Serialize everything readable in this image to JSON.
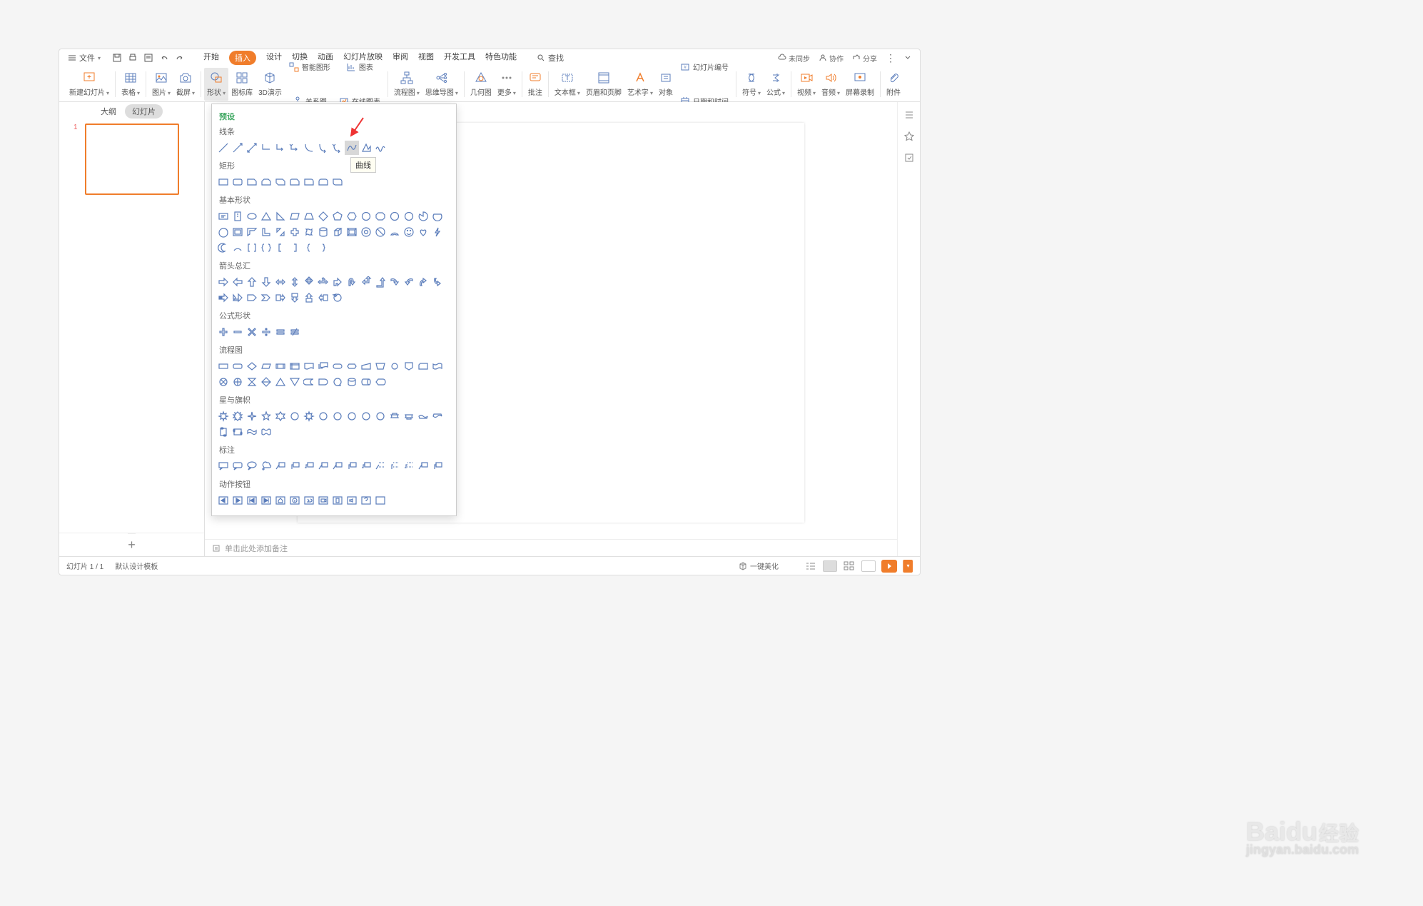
{
  "menu": {
    "file": "文件",
    "tabs": [
      "开始",
      "插入",
      "设计",
      "切换",
      "动画",
      "幻灯片放映",
      "审阅",
      "视图",
      "开发工具",
      "特色功能"
    ],
    "active_tab_index": 1,
    "search": "查找"
  },
  "menubar_right": {
    "unsync": "未同步",
    "collab": "协作",
    "share": "分享"
  },
  "ribbon": {
    "new_slide": "新建幻灯片",
    "table": "表格",
    "image": "图片",
    "screenshot": "截屏",
    "shape": "形状",
    "icon_lib": "图标库",
    "three_d": "3D演示",
    "smart_graphic": "智能图形",
    "relation_chart": "关系图",
    "chart": "图表",
    "online_chart": "在线图表",
    "flowchart": "流程图",
    "mindmap": "思维导图",
    "geometry": "几何图",
    "more": "更多",
    "comment": "批注",
    "textbox": "文本框",
    "header_footer": "页眉和页脚",
    "wordart": "艺术字",
    "object": "对象",
    "slide_number": "幻灯片编号",
    "date_time": "日期和时间",
    "symbol": "符号",
    "formula": "公式",
    "video": "视频",
    "audio": "音频",
    "screen_record": "屏幕录制",
    "attachment": "附件"
  },
  "sidebar": {
    "tabs": [
      "大纲",
      "幻灯片"
    ],
    "active": 1,
    "slide_number": "1"
  },
  "shapes_panel": {
    "preset": "预设",
    "sections": {
      "lines": "线条",
      "rectangles": "矩形",
      "basic_shapes": "基本形状",
      "block_arrows": "箭头总汇",
      "equation": "公式形状",
      "flowchart": "流程图",
      "stars": "星与旗帜",
      "callouts": "标注",
      "action_buttons": "动作按钮"
    }
  },
  "tooltip": "曲线",
  "notes_placeholder": "单击此处添加备注",
  "statusbar": {
    "slide_count": "幻灯片 1 / 1",
    "template": "默认设计模板",
    "beautify": "一键美化"
  },
  "watermark": {
    "brand": "Baidu",
    "suffix": "经验",
    "url": "jingyan.baidu.com"
  }
}
